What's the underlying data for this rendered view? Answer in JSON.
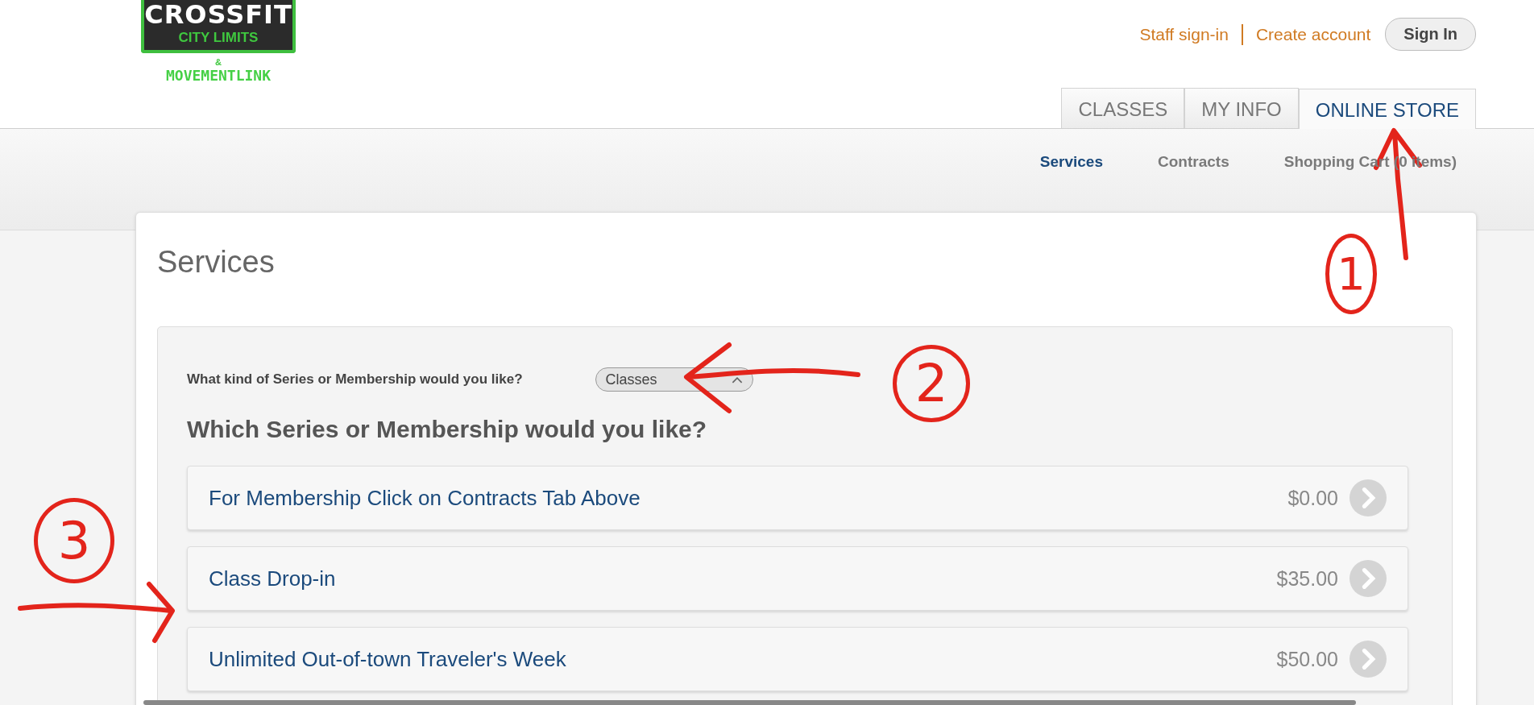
{
  "logo": {
    "title": "CROSSFIT",
    "subtitle": "CITY LIMITS",
    "joiner": "&",
    "partner": "MOVEMENTLINK"
  },
  "header_links": [
    "Staff sign-in",
    "Create account"
  ],
  "sign_in": "Sign In",
  "tabs": [
    {
      "label": "CLASSES",
      "selected": false
    },
    {
      "label": "MY INFO",
      "selected": false
    },
    {
      "label": "ONLINE STORE",
      "selected": true
    }
  ],
  "subnav": [
    {
      "label": "Services",
      "selected": true
    },
    {
      "label": "Contracts",
      "selected": false
    },
    {
      "label": "Shopping Cart (0 items)",
      "selected": false
    }
  ],
  "page_title": "Services",
  "kind_question": "What kind of Series or Membership would you like?",
  "kind_select": {
    "value": "Classes"
  },
  "list_heading": "Which Series or Membership would you like?",
  "services": [
    {
      "name": "For Membership Click on Contracts Tab Above",
      "price": "$0.00"
    },
    {
      "name": "Class Drop-in",
      "price": "$35.00"
    },
    {
      "name": "Unlimited Out-of-town Traveler's Week",
      "price": "$50.00"
    }
  ],
  "annotations": [
    {
      "label": "1"
    },
    {
      "label": "2"
    },
    {
      "label": "3"
    }
  ]
}
